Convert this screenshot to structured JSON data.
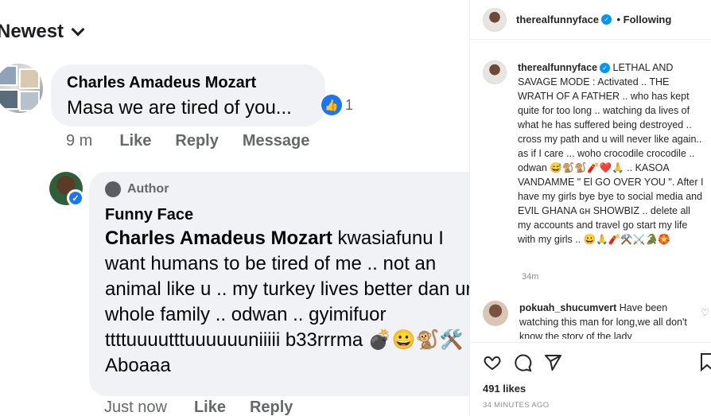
{
  "facebook": {
    "sort_label": "Newest",
    "comment1": {
      "name": "Charles Amadeus Mozart",
      "text": "Masa we are tired of you...",
      "reaction_count": "1",
      "time": "9 m",
      "like_label": "Like",
      "reply_label": "Reply",
      "message_label": "Message"
    },
    "reply": {
      "author_badge": "Author",
      "name": "Funny Face",
      "mention": "Charles Amadeus Mozart",
      "text": " kwasiafunu I want humans to be tired of me .. not an animal like u .. my turkey lives better dan ur whole family .. odwan .. gyimifuor ttttuuuutttuuuuuuniiiii b33rrrma 💣😀🐒🛠️ Aboaaa",
      "time": "Just now",
      "like_label": "Like",
      "reply_label": "Reply"
    }
  },
  "instagram": {
    "header_username": "therealfunnyface",
    "following_label": "• Following",
    "caption_username": "therealfunnyface",
    "caption": " LETHAL AND SAVAGE MODE : Activated .. THE WRATH OF A FATHER .. who has kept quite for too long .. watching da lives of what he has suffered being destroyed .. cross my path and u will never like again.. as if I care ... woho crocodile crocodile .. odwan 😅🐒🐒🧨❤️🙏 .. KASOA VANDAMME \" El GO OVER YOU \". After I have my girls bye bye to social media and EVIL GHANA ɢʜ SHOWBIZ .. delete all my accounts and travel go start my life with my girls .. 😀🙏🧨⚒️⚔️🐊🏵️",
    "caption_time": "34m",
    "comment_username": "pokuah_shucumvert",
    "comment_text": " Have been watching this man for long,we all don't know the story of the lady",
    "likes": "491 likes",
    "date": "34 MINUTES AGO"
  },
  "icons": {
    "heart": "heart-icon",
    "comment": "comment-icon",
    "share": "share-icon",
    "save": "save-icon",
    "like_reaction": "thumbs-up-icon",
    "verified": "verified-badge-icon"
  },
  "colors": {
    "fb_bubble": "#f0f2f5",
    "fb_blue": "#1877f2",
    "ig_blue": "#0095f6",
    "muted": "#65676b"
  }
}
